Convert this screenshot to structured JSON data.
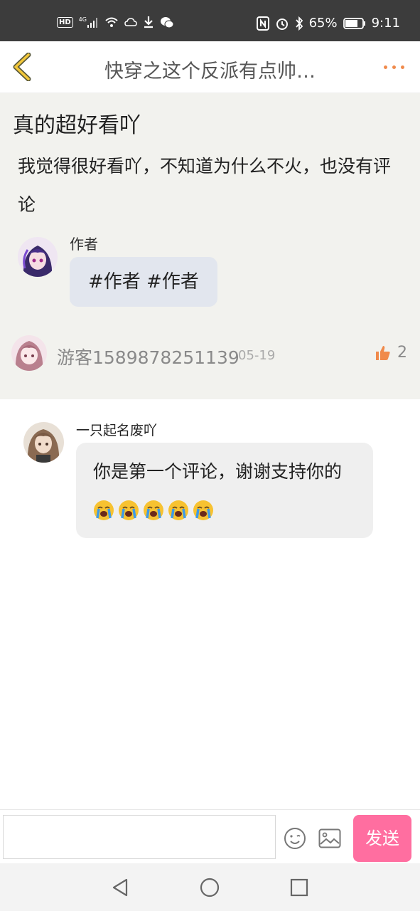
{
  "status_bar": {
    "hd": "HD",
    "network": "4G",
    "battery": "65%",
    "time": "9:11"
  },
  "nav": {
    "title": "快穿之这个反派有点帅…"
  },
  "post": {
    "title": "真的超好看吖",
    "body": "我觉得很好看吖，不知道为什么不火，也没有评论",
    "author_label": "作者",
    "tags": "#作者 #作者",
    "commenter": "游客1589878251139",
    "date": "05-19",
    "likes": "2"
  },
  "reply": {
    "name": "一只起名废吖",
    "text": "你是第一个评论，谢谢支持你的",
    "emoji_count": 5,
    "emoji": "loudly-crying-face"
  },
  "input": {
    "placeholder": "",
    "send_label": "发送"
  },
  "colors": {
    "accent": "#f08a4b",
    "send": "#ff6ea0",
    "post_bg": "#f2f2ee",
    "tag_bubble": "#e2e6ee",
    "reply_bubble": "#efefef",
    "status_bar": "#3c3c3c"
  }
}
